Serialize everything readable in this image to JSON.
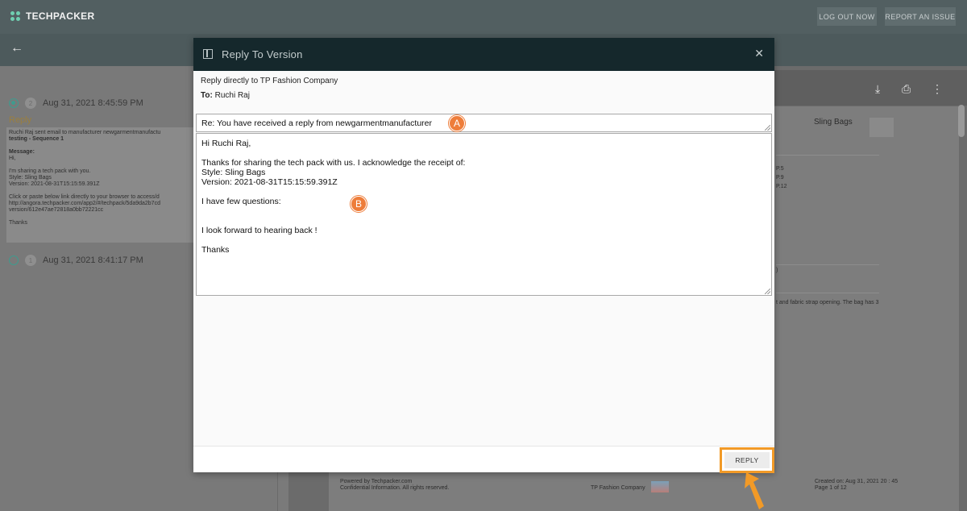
{
  "app": {
    "logo_text": "TECHPACKER",
    "brand_color": "#6fcfb0"
  },
  "header": {
    "logout_label": "LOG OUT NOW",
    "report_label": "REPORT AN ISSUE"
  },
  "versions": {
    "item1": {
      "number": "2",
      "date": "Aug 31, 2021 8:45:59 PM",
      "reply_label": "Reply",
      "message_lines": [
        "Ruchi Raj sent email to manufacturer newgarmentmanufactu",
        "testing - Sequence 1",
        "",
        "Message:",
        "Hi,",
        "",
        "I'm sharing a tech pack with you.",
        "Style: Sling Bags",
        "Version: 2021-08-31T15:15:59.391Z",
        "",
        "Click or paste below link directly to your browser to access/d",
        "http://angora.techpacker.com/app2/#/techpack/5da9da2b7cd",
        "version/612e47ae72818a0bb72221cc",
        "",
        "Thanks"
      ]
    },
    "item2": {
      "number": "1",
      "date": "Aug 31, 2021 8:41:17 PM"
    }
  },
  "document": {
    "title": "Sling Bags",
    "refs": [
      "P.5",
      "P.9",
      "P.12"
    ],
    "desc_fragment": "t and fabric strap opening. The bag has 3",
    "paren": ")",
    "footer_powered": "Powered by Techpacker.com",
    "footer_confidential": "Confidential Information. All rights reserved.",
    "footer_company": "TP Fashion Company",
    "footer_created": "Created on: Aug 31, 2021 20 : 45",
    "footer_page": "Page 1 of 12"
  },
  "modal": {
    "title": "Reply To Version",
    "reply_directly": "Reply directly to TP Fashion Company",
    "to_label": "To:",
    "to_value": "Ruchi Raj",
    "subject": "Re: You have received a reply from newgarmentmanufacturer",
    "body": {
      "greeting": "Hi Ruchi Raj,",
      "line1": "Thanks for sharing the tech pack with us. I acknowledge the receipt of:",
      "line2": "Style: Sling Bags",
      "line3": "Version: 2021-08-31T15:15:59.391Z",
      "line4": "I have few questions:",
      "line5": "I look forward to hearing back !",
      "line6": "Thanks"
    },
    "reply_button": "REPLY"
  },
  "annotations": {
    "marker_a": "A",
    "marker_b": "B",
    "accent": "#f29a27"
  }
}
